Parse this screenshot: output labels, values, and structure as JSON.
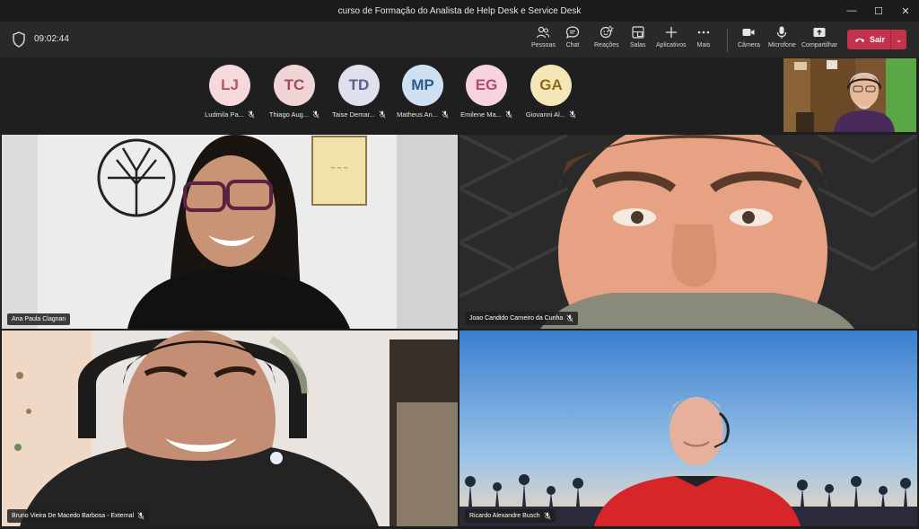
{
  "window": {
    "title": "curso de Formação do Analista de Help Desk e Service Desk"
  },
  "toolbar": {
    "timer": "09:02:44",
    "buttons": [
      {
        "label": "Pessoas",
        "icon": "people-icon"
      },
      {
        "label": "Chat",
        "icon": "chat-icon"
      },
      {
        "label": "Reações",
        "icon": "reactions-icon"
      },
      {
        "label": "Salas",
        "icon": "rooms-icon"
      },
      {
        "label": "Aplicativos",
        "icon": "plus-icon"
      },
      {
        "label": "Mais",
        "icon": "more-icon"
      },
      {
        "label": "Câmera",
        "icon": "camera-icon"
      },
      {
        "label": "Microfone",
        "icon": "microphone-icon"
      },
      {
        "label": "Compartilhar",
        "icon": "share-icon"
      }
    ],
    "leave_label": "Sair"
  },
  "participants": [
    {
      "initials": "LJ",
      "name": "Ludmila Pa...",
      "color": "#b8555e",
      "bg": "#f6d9dc"
    },
    {
      "initials": "TC",
      "name": "Thiago Aug...",
      "color": "#a14c52",
      "bg": "#f1d4d6"
    },
    {
      "initials": "TD",
      "name": "Taise Demar...",
      "color": "#5b5f8f",
      "bg": "#dfe0ee"
    },
    {
      "initials": "MP",
      "name": "Matheus An...",
      "color": "#2e5a8a",
      "bg": "#cfe0f3"
    },
    {
      "initials": "EG",
      "name": "Emilene Ma...",
      "color": "#b24a6c",
      "bg": "#f7d3e0"
    },
    {
      "initials": "GA",
      "name": "Giovanni Al...",
      "color": "#8a6a1a",
      "bg": "#f5e6b8"
    }
  ],
  "tiles": [
    {
      "name": "Ana Paula Clagnan",
      "muted": false
    },
    {
      "name": "Joao Candido Carneiro da Cunha",
      "muted": true
    },
    {
      "name": "Bruno Vieira De Macedo Barbosa - External",
      "muted": true
    },
    {
      "name": "Ricardo Alexandre Busch",
      "muted": true
    }
  ],
  "colors": {
    "leave": "#c4314b",
    "toolbar": "#292929",
    "background": "#1f1f1f"
  }
}
